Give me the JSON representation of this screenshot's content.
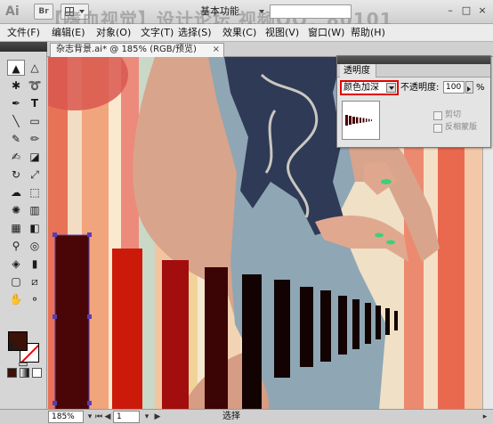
{
  "app": {
    "logo": "Ai",
    "bridge_button": "Br",
    "workspace": "基本功能",
    "watermark": "【嗜血视觉】设计论坛 视频QQ：80101",
    "minimize": "–",
    "restore": "□",
    "close": "×"
  },
  "menu": [
    {
      "label": "文件(F)"
    },
    {
      "label": "编辑(E)"
    },
    {
      "label": "对象(O)"
    },
    {
      "label": "文字(T)"
    },
    {
      "label": "选择(S)"
    },
    {
      "label": "效果(C)"
    },
    {
      "label": "视图(V)"
    },
    {
      "label": "窗口(W)"
    },
    {
      "label": "帮助(H)"
    }
  ],
  "document": {
    "tab_title": "杂志背景.ai* @ 185% (RGB/预览)",
    "close": "×"
  },
  "transparency_panel": {
    "title": "透明度",
    "blend_mode": "颜色加深",
    "opacity_label": "不透明度:",
    "opacity_value": "100",
    "opacity_unit": "%",
    "clip_label": "剪切",
    "invert_mask_label": "反相蒙版"
  },
  "status": {
    "zoom": "185%",
    "page": "1",
    "tool_text": "选择"
  },
  "colors": {
    "fill": "#3b1208",
    "stroke": "#ffffff",
    "highlight": "#e00000"
  },
  "tools": [
    "selection-tool-icon",
    "direct-selection-tool-icon",
    "magic-wand-icon",
    "lasso-icon",
    "pen-tool-icon",
    "type-tool-icon",
    "line-tool-icon",
    "rectangle-tool-icon",
    "paintbrush-icon",
    "pencil-icon",
    "blob-brush-icon",
    "eraser-icon",
    "rotate-tool-icon",
    "scale-tool-icon",
    "warp-tool-icon",
    "free-transform-icon",
    "symbol-sprayer-icon",
    "graph-tool-icon",
    "mesh-tool-icon",
    "gradient-tool-icon",
    "eyedropper-icon",
    "blend-tool-icon",
    "live-paint-icon",
    "column-graph-icon",
    "artboard-tool-icon",
    "slice-tool-icon",
    "hand-tool-icon",
    "zoom-tool-icon"
  ]
}
